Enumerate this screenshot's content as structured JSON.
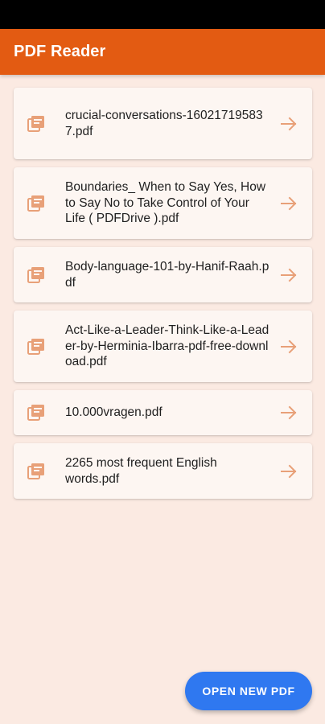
{
  "app": {
    "title": "PDF Reader"
  },
  "colors": {
    "app_bar": "#e35b12",
    "background": "#fbeae2",
    "card": "#fdf6f2",
    "accent_icon": "#e8a078",
    "fab": "#2f78f0"
  },
  "files": [
    {
      "name": "crucial-conversations-160217195837.pdf",
      "icon": "pdf-file-icon",
      "action_icon": "arrow-right-icon"
    },
    {
      "name": "Boundaries_ When to Say Yes, How to Say No to Take Control of Your Life ( PDFDrive ).pdf",
      "icon": "pdf-file-icon",
      "action_icon": "arrow-right-icon"
    },
    {
      "name": "Body-language-101-by-Hanif-Raah.pdf",
      "icon": "pdf-file-icon",
      "action_icon": "arrow-right-icon"
    },
    {
      "name": "Act-Like-a-Leader-Think-Like-a-Leader-by-Herminia-Ibarra-pdf-free-download.pdf",
      "icon": "pdf-file-icon",
      "action_icon": "arrow-right-icon"
    },
    {
      "name": "10.000vragen.pdf",
      "icon": "pdf-file-icon",
      "action_icon": "arrow-right-icon"
    },
    {
      "name": "2265 most frequent English words.pdf",
      "icon": "pdf-file-icon",
      "action_icon": "arrow-right-icon"
    }
  ],
  "fab": {
    "label": "OPEN NEW PDF"
  }
}
